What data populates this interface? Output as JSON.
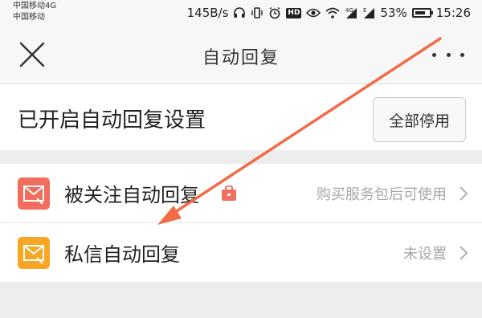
{
  "status_bar": {
    "carrier_line1": "中国移动4G",
    "carrier_line2": "中国移动",
    "speed": "145B/s",
    "battery": "53%",
    "time": "15:26",
    "icons": [
      "headphones-icon",
      "vibrate-icon",
      "alarm-icon",
      "hd-icon",
      "eye-icon",
      "wifi-icon",
      "signal-4g-icon",
      "signal-e-icon",
      "battery-icon"
    ],
    "hd_label": "HD"
  },
  "navbar": {
    "title": "自动回复"
  },
  "settings": {
    "title": "已开启自动回复设置",
    "stop_all": "全部停用"
  },
  "items": [
    {
      "label": "被关注自动回复",
      "value": "购买服务包后可使用",
      "icon": "follow-reply-mail-icon",
      "icon_color": "#f16d5d"
    },
    {
      "label": "私信自动回复",
      "value": "未设置",
      "icon": "message-reply-mail-icon",
      "icon_color": "#f8a623"
    }
  ],
  "colors": {
    "arrow": "#f26b46",
    "lock_bag": "#f16d5d"
  }
}
